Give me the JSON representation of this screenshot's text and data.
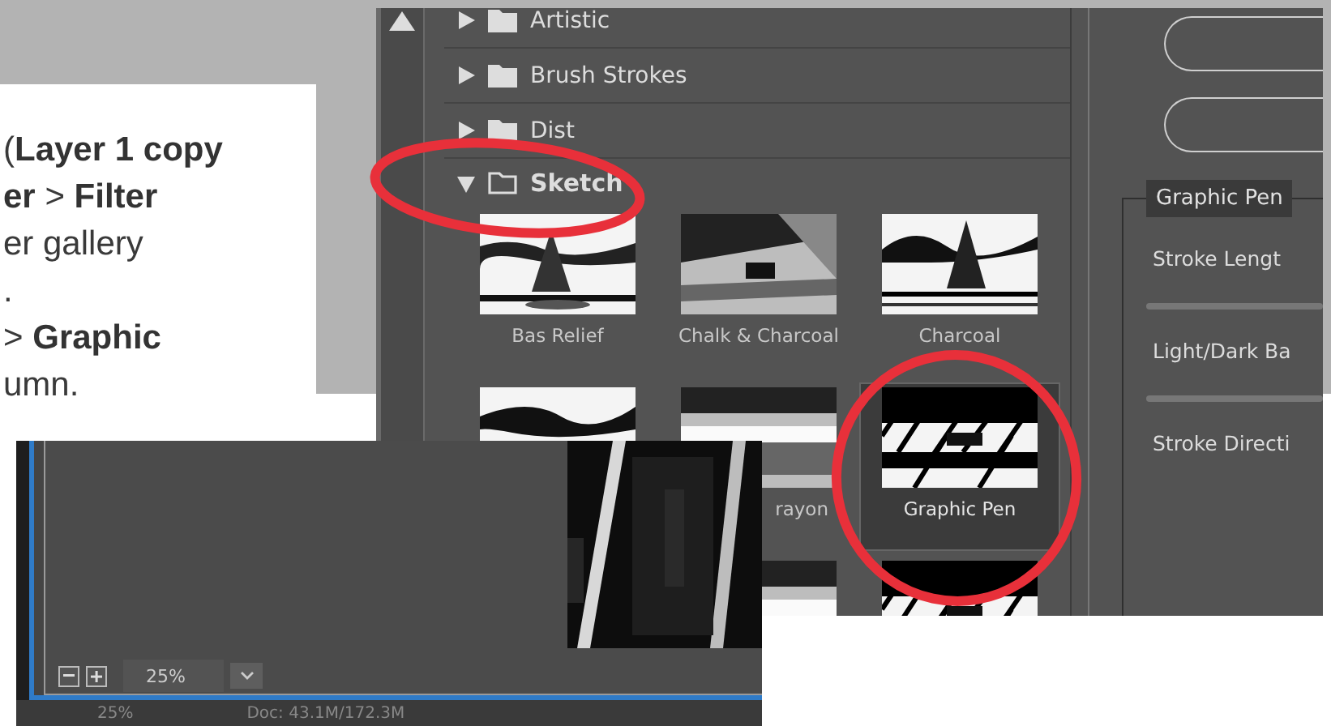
{
  "instructions": {
    "lines": [
      "(**Layer 1 copy**",
      "**er** > **Filter**",
      "er gallery",
      ".",
      "> **Graphic**",
      "umn."
    ]
  },
  "filter_gallery": {
    "categories": [
      {
        "label": "Artistic",
        "expanded": false
      },
      {
        "label": "Brush Strokes",
        "expanded": false
      },
      {
        "label": "Dist",
        "expanded": false
      },
      {
        "label": "Sketch",
        "expanded": true
      }
    ],
    "filters": [
      {
        "label": "Bas Relief",
        "selected": false
      },
      {
        "label": "Chalk & Charcoal",
        "selected": false
      },
      {
        "label": "Charcoal",
        "selected": false
      },
      {
        "selected": false
      },
      {
        "label": "rayon",
        "selected": false,
        "clipped_left": true
      },
      {
        "label": "Graphic Pen",
        "selected": true
      }
    ]
  },
  "settings_panel": {
    "filter_name": "Graphic Pen",
    "settings": [
      "Stroke Lengt",
      "Light/Dark Ba",
      "Stroke Directi"
    ]
  },
  "canvas_window": {
    "zoom": "25%",
    "status_zoom": "25%",
    "doc_info": "Doc: 43.1M/172.3M"
  }
}
